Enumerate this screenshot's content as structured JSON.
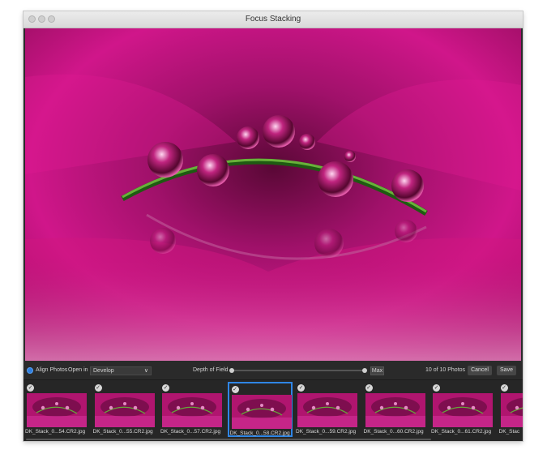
{
  "window": {
    "title": "Focus Stacking"
  },
  "toolbar": {
    "align_label": "Align Photos",
    "open_in_label": "Open in",
    "open_in_value": "Develop",
    "depth_label": "Depth of Field",
    "max_label": "Max",
    "count_label": "10 of 10 Photos",
    "cancel_label": "Cancel",
    "save_label": "Save"
  },
  "filmstrip": {
    "items": [
      {
        "name": "DK_Stack_0...54.CR2.jpg"
      },
      {
        "name": "DK_Stack_0...55.CR2.jpg"
      },
      {
        "name": "DK_Stack_0...57.CR2.jpg"
      },
      {
        "name": "DK_Stack_0...58.CR2.jpg"
      },
      {
        "name": "DK_Stack_0...59.CR2.jpg"
      },
      {
        "name": "DK_Stack_0...60.CR2.jpg"
      },
      {
        "name": "DK_Stack_0...61.CR2.jpg"
      },
      {
        "name": "DK_Stac"
      }
    ],
    "selected_index": 3
  },
  "colors": {
    "accent": "#2f86e6",
    "flower": "#c4127e"
  }
}
